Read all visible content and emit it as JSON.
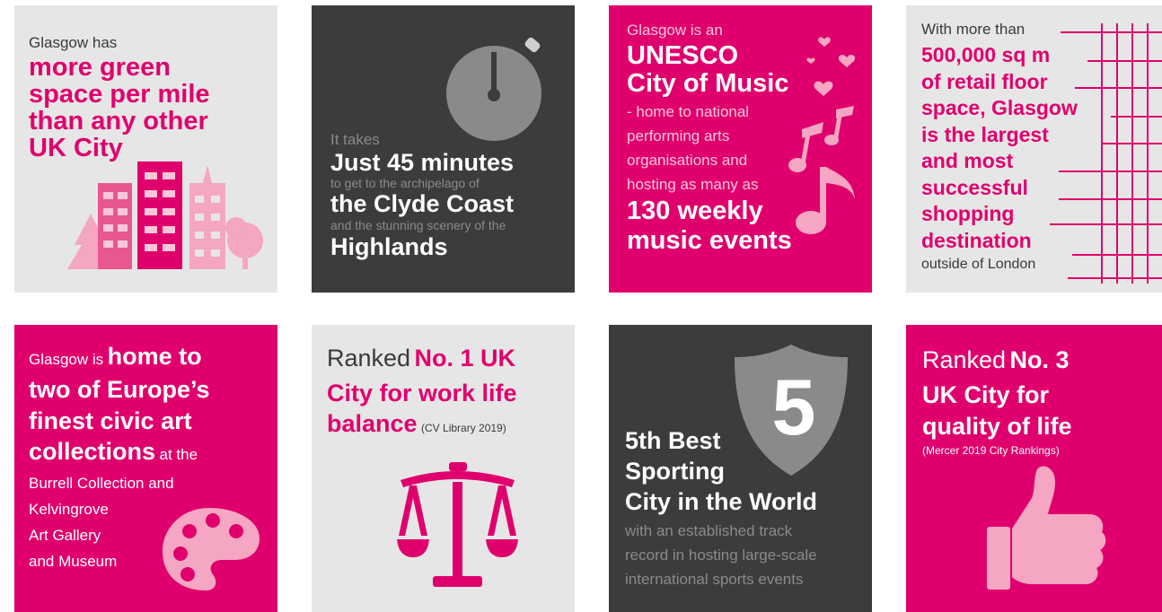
{
  "colors": {
    "pink": "#e0006d",
    "light_pink": "#f4a6c2",
    "dark": "#3c3c3c",
    "light": "#e6e6e6"
  },
  "tile1": {
    "intro": "Glasgow has",
    "headline": [
      "more green",
      "space per mile",
      "than any other",
      "UK City"
    ],
    "icon": "city-buildings-icon"
  },
  "tile2": {
    "intro": "It takes",
    "line1": "Just 45 minutes",
    "sub1": "to get to the archipelago of",
    "line2": "the Clyde Coast",
    "sub2": "and the stunning scenery of the",
    "line3": "Highlands",
    "icon": "stopwatch-icon"
  },
  "tile3": {
    "intro": "Glasgow is an",
    "headline": [
      "UNESCO",
      "City of Music"
    ],
    "body": [
      "- home to national",
      "performing arts",
      "organisations and",
      "hosting as many as"
    ],
    "footer": [
      "130 weekly",
      "music events"
    ],
    "icon": "music-notes-icon"
  },
  "tile4": {
    "intro": "With more than",
    "headline": [
      "500,000 sq m",
      "of retail floor",
      "space, Glasgow",
      "is the largest",
      "and most",
      "successful",
      "shopping",
      "destination"
    ],
    "footer": "outside of London",
    "icon": "grid-lines-icon"
  },
  "tile5": {
    "intro": "Glasgow is",
    "headline_inline": "home to",
    "headline": [
      "two of Europe’s",
      "finest civic art"
    ],
    "headline_last": "collections",
    "tail": "at the",
    "body": [
      "Burrell Collection and",
      "Kelvingrove",
      "Art Gallery",
      "and Museum"
    ],
    "icon": "paint-palette-icon"
  },
  "tile6": {
    "intro": "Ranked",
    "headline_inline": "No. 1 UK",
    "headline": [
      "City for work life"
    ],
    "headline_last": "balance",
    "source": "(CV Library 2019)",
    "icon": "balance-scales-icon"
  },
  "tile7": {
    "badge_number": "5",
    "headline": [
      "5th Best",
      "Sporting",
      "City in the World"
    ],
    "body": [
      "with an established track",
      "record in hosting large-scale",
      "international sports events"
    ],
    "icon": "shield-badge-icon"
  },
  "tile8": {
    "intro": "Ranked",
    "headline_inline": "No. 3",
    "headline": [
      "UK City for",
      "quality of life"
    ],
    "source": "(Mercer 2019 City Rankings)",
    "icon": "thumbs-up-icon"
  }
}
